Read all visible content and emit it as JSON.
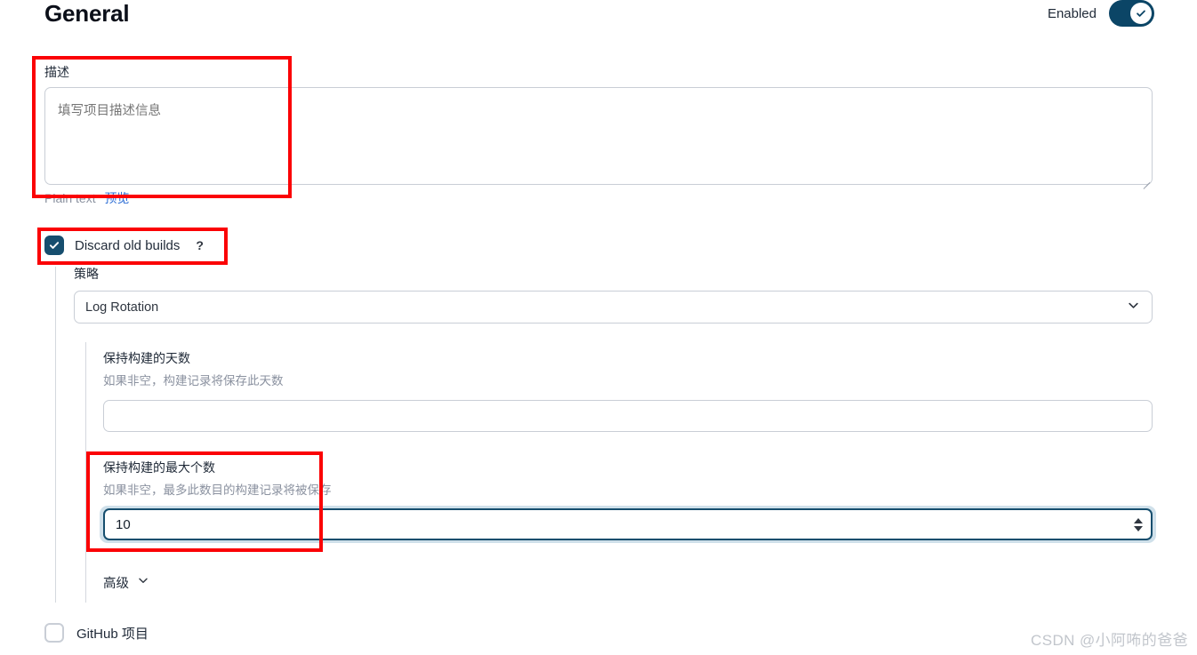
{
  "header": {
    "title": "General",
    "enabled_label": "Enabled",
    "enabled_state": "on"
  },
  "description_section": {
    "label": "描述",
    "placeholder": "填写项目描述信息",
    "value": "",
    "format_hint": "Plain text",
    "preview_link": "预览"
  },
  "discard_old_builds": {
    "label": "Discard old builds",
    "checked": true,
    "help_icon": "?",
    "strategy": {
      "label": "策略",
      "selected": "Log Rotation",
      "options": [
        "Log Rotation"
      ]
    },
    "days_to_keep": {
      "label": "保持构建的天数",
      "description": "如果非空，构建记录将保存此天数",
      "value": ""
    },
    "max_builds_to_keep": {
      "label": "保持构建的最大个数",
      "description": "如果非空，最多此数目的构建记录将被保存",
      "value": "10"
    },
    "advanced_label": "高级"
  },
  "github_project": {
    "label": "GitHub 项目",
    "checked": false
  },
  "watermark": "CSDN @小阿咘的爸爸",
  "colors": {
    "accent": "#0b4566",
    "checkbox_checked": "#164e6e",
    "link": "#2b6cd4",
    "annotation": "#fb0205",
    "border": "#c9ced6",
    "muted_text": "#8b92a0"
  }
}
